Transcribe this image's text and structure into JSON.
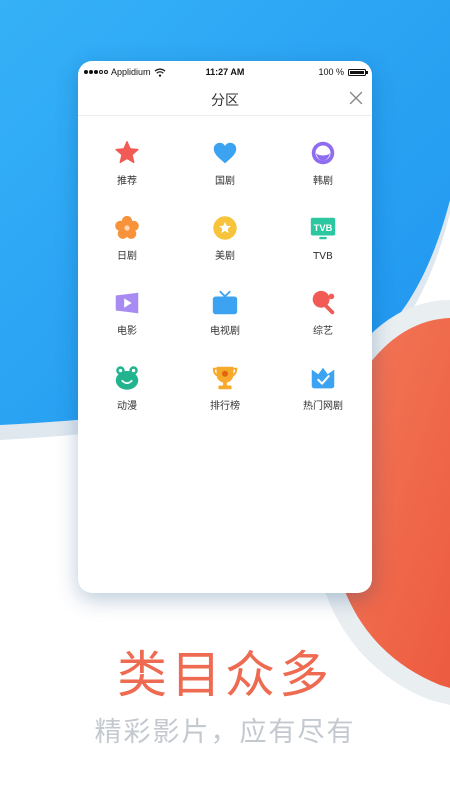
{
  "status_bar": {
    "carrier": "Applidium",
    "time": "11:27 AM",
    "battery": "100 %"
  },
  "nav": {
    "title": "分区"
  },
  "categories": [
    {
      "label": "推荐",
      "icon": "star-icon"
    },
    {
      "label": "国剧",
      "icon": "heart-icon"
    },
    {
      "label": "韩剧",
      "icon": "planet-icon"
    },
    {
      "label": "日剧",
      "icon": "flower-icon"
    },
    {
      "label": "美剧",
      "icon": "star-coin-icon"
    },
    {
      "label": "TVB",
      "icon": "tvb-icon",
      "icon_text": "TVB"
    },
    {
      "label": "电影",
      "icon": "movie-play-icon"
    },
    {
      "label": "电视剧",
      "icon": "television-icon"
    },
    {
      "label": "综艺",
      "icon": "ping-pong-icon"
    },
    {
      "label": "动漫",
      "icon": "frog-icon"
    },
    {
      "label": "排行榜",
      "icon": "trophy-icon"
    },
    {
      "label": "热门网剧",
      "icon": "crown-check-icon"
    }
  ],
  "promo": {
    "headline": "类目众多",
    "subtitle": "精彩影片，应有尽有"
  },
  "colors": {
    "blue": "#2ea8f5",
    "coral": "#ef6449",
    "headline": "#ee6a50",
    "subtitle": "#c4c9d0"
  }
}
